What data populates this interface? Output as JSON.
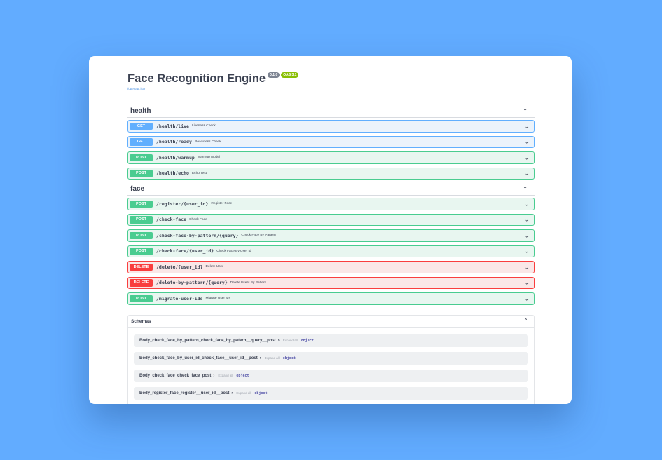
{
  "info": {
    "title": "Face Recognition Engine",
    "version": "0.1.0",
    "oas": "OAS 3.1",
    "spec_link": "/openapi.json"
  },
  "tags": [
    {
      "name": "health",
      "operations": [
        {
          "method": "GET",
          "path": "/health/live",
          "summary": "Liveness Check"
        },
        {
          "method": "GET",
          "path": "/health/ready",
          "summary": "Readiness Check"
        },
        {
          "method": "POST",
          "path": "/health/warmup",
          "summary": "Warmup Model"
        },
        {
          "method": "POST",
          "path": "/health/echo",
          "summary": "Echo Test"
        }
      ]
    },
    {
      "name": "face",
      "operations": [
        {
          "method": "POST",
          "path": "/register/{user_id}",
          "summary": "Register Face"
        },
        {
          "method": "POST",
          "path": "/check-face",
          "summary": "Check Face"
        },
        {
          "method": "POST",
          "path": "/check-face-by-pattern/{query}",
          "summary": "Check Face By Pattern"
        },
        {
          "method": "POST",
          "path": "/check-face/{user_id}",
          "summary": "Check Face By User Id"
        },
        {
          "method": "DELETE",
          "path": "/delete/{user_id}",
          "summary": "Delete User"
        },
        {
          "method": "DELETE",
          "path": "/delete-by-pattern/{query}",
          "summary": "Delete Users By Pattern"
        },
        {
          "method": "POST",
          "path": "/migrate-user-ids",
          "summary": "Migrate User Ids"
        }
      ]
    }
  ],
  "schemas": {
    "title": "Schemas",
    "items": [
      {
        "name": "Body_check_face_by_pattern_check_face_by_patern__query__post",
        "expand": "Expand all",
        "type": "object"
      },
      {
        "name": "Body_check_face_by_user_id_check_face__user_id__post",
        "expand": "Expand all",
        "type": "object"
      },
      {
        "name": "Body_check_face_check_face_post",
        "expand": "Expand all",
        "type": "object"
      },
      {
        "name": "Body_register_face_register__user_id__post",
        "expand": "Expand all",
        "type": "object"
      }
    ]
  },
  "colors": {
    "background": "#62acff",
    "get": "#61affe",
    "post": "#49cc90",
    "delete": "#f93e3e"
  },
  "icons": {
    "collapse": "chevron-up-icon",
    "expand": "chevron-down-icon",
    "model_arrow": "chevron-right-icon"
  }
}
